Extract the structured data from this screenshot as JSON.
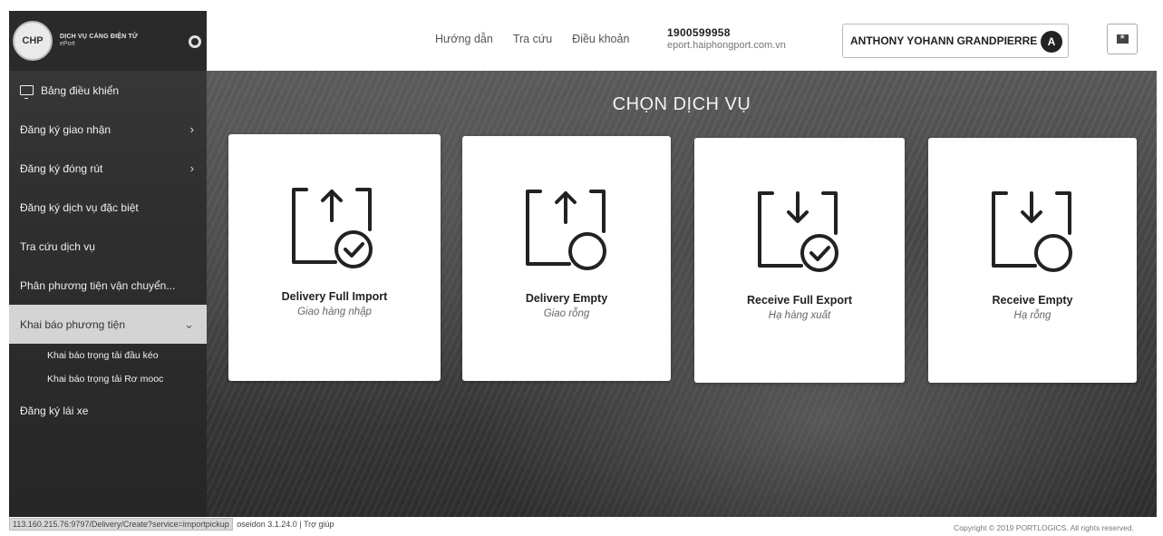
{
  "brand": {
    "title": "DỊCH VỤ CẢNG ĐIỆN TỬ",
    "subtitle": "ePort",
    "logo_text": "CHP"
  },
  "sidebar": {
    "items": [
      {
        "label": "Bảng điều khiển",
        "chevron": "",
        "icon": "monitor-icon"
      },
      {
        "label": "Đăng ký giao nhận",
        "chevron": "›"
      },
      {
        "label": "Đăng ký đóng rút",
        "chevron": "›"
      },
      {
        "label": "Đăng ký dịch vụ đặc biệt",
        "chevron": ""
      },
      {
        "label": "Tra cứu dịch vụ",
        "chevron": ""
      },
      {
        "label": "Phân phương tiện vận chuyển...",
        "chevron": ""
      },
      {
        "label": "Khai báo phương tiện",
        "chevron": "⌄"
      },
      {
        "label": "Đăng ký lái xe",
        "chevron": ""
      }
    ],
    "subitems": [
      {
        "label": "Khai báo trọng tải đầu kéo"
      },
      {
        "label": "Khai báo trọng tải Rơ mooc"
      }
    ]
  },
  "header": {
    "links": [
      "Hướng dẫn",
      "Tra cứu",
      "Điều khoản"
    ],
    "phone": "1900599958",
    "website": "eport.haiphongport.com.vn",
    "user_name": "ANTHONY YOHANN GRANDPIERRE",
    "user_initial": "A"
  },
  "main": {
    "title": "CHỌN DỊCH VỤ",
    "cards": [
      {
        "title": "Delivery Full Import",
        "subtitle": "Giao hàng nhập",
        "icon": "arrow-up-check-icon"
      },
      {
        "title": "Delivery Empty",
        "subtitle": "Giao rỗng",
        "icon": "arrow-up-empty-icon"
      },
      {
        "title": "Receive Full Export",
        "subtitle": "Hạ hàng xuất",
        "icon": "arrow-down-check-icon"
      },
      {
        "title": "Receive Empty",
        "subtitle": "Hạ rỗng",
        "icon": "arrow-down-empty-icon"
      }
    ]
  },
  "footer": {
    "status_url": "113.160.215.76:9797/Delivery/Create?service=importpickup",
    "version": "oseidon 3.1.24.0 | Trợ giúp",
    "copyright": "Copyright © 2019 PORTLOGICS. All rights reserved."
  }
}
